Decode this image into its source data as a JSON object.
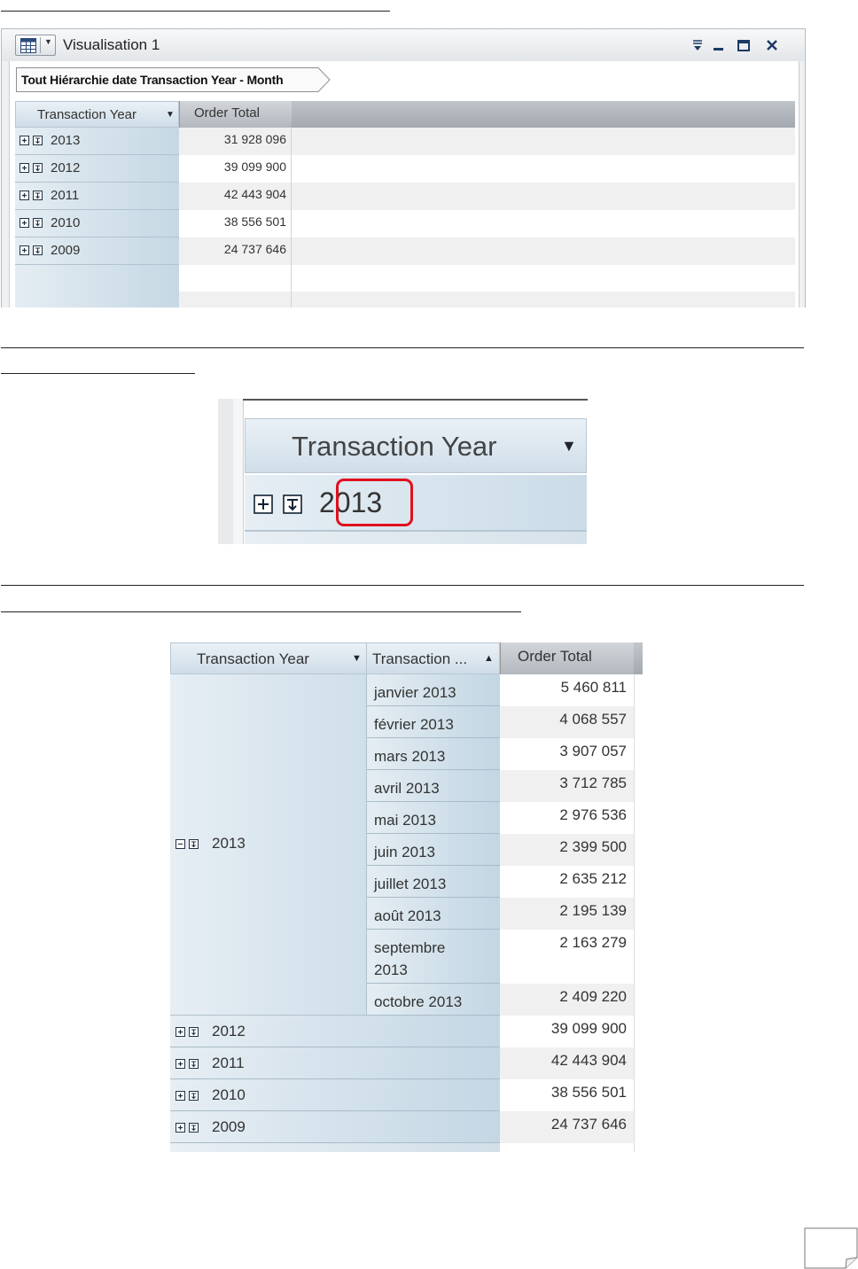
{
  "panel1": {
    "window_title": "Visualisation 1",
    "breadcrumb": "Tout Hiérarchie date Transaction Year - Month",
    "col_year": "Transaction Year",
    "col_total": "Order Total",
    "rows": [
      {
        "year": "2013",
        "total": "31 928 096"
      },
      {
        "year": "2012",
        "total": "39 099 900"
      },
      {
        "year": "2011",
        "total": "42 443 904"
      },
      {
        "year": "2010",
        "total": "38 556 501"
      },
      {
        "year": "2009",
        "total": "24 737 646"
      }
    ],
    "icons": [
      "table-view-icon",
      "dropdown-arrow-icon",
      "menu-icon",
      "minimize-icon",
      "maximize-icon",
      "close-icon",
      "expand-plus-icon",
      "drill-down-icon"
    ]
  },
  "panel2": {
    "col_year": "Transaction Year",
    "year": "2013",
    "highlight_color": "#e0101e"
  },
  "panel3": {
    "col_year": "Transaction Year",
    "col_month": "Transaction ...",
    "col_total": "Order Total",
    "expanded_year": "2013",
    "months": [
      {
        "label": "janvier 2013",
        "total": "5 460 811"
      },
      {
        "label": "février 2013",
        "total": "4 068 557"
      },
      {
        "label": "mars 2013",
        "total": "3 907 057"
      },
      {
        "label": "avril 2013",
        "total": "3 712 785"
      },
      {
        "label": "mai 2013",
        "total": "2 976 536"
      },
      {
        "label": "juin 2013",
        "total": "2 399 500"
      },
      {
        "label": "juillet 2013",
        "total": "2 635 212"
      },
      {
        "label": "août 2013",
        "total": "2 195 139"
      },
      {
        "label": "septembre 2013",
        "total": "2 163 279"
      },
      {
        "label": "octobre 2013",
        "total": "2 409 220"
      }
    ],
    "other_years": [
      {
        "year": "2012",
        "total": "39 099 900"
      },
      {
        "year": "2011",
        "total": "42 443 904"
      },
      {
        "year": "2010",
        "total": "38 556 501"
      },
      {
        "year": "2009",
        "total": "24 737 646"
      }
    ],
    "icons": [
      "collapse-minus-icon",
      "expand-plus-icon",
      "drill-down-icon",
      "sort-ascending-icon",
      "sort-descending-icon"
    ]
  }
}
